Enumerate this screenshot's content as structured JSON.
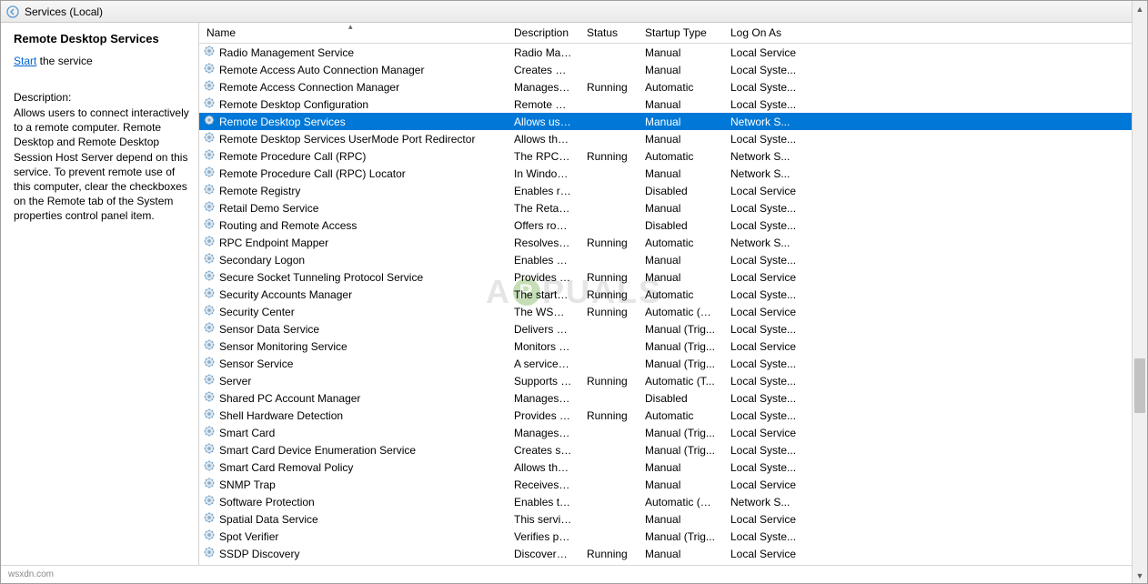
{
  "header": {
    "title": "Services (Local)"
  },
  "leftPane": {
    "serviceName": "Remote Desktop Services",
    "actionPrefix": "Start",
    "actionSuffix": " the service",
    "descLabel": "Description:",
    "descText": "Allows users to connect interactively to a remote computer. Remote Desktop and Remote Desktop Session Host Server depend on this service.  To prevent remote use of this computer, clear the checkboxes on the Remote tab of the System properties control panel item."
  },
  "columns": {
    "name": "Name",
    "description": "Description",
    "status": "Status",
    "startupType": "Startup Type",
    "logOnAs": "Log On As"
  },
  "selectedIndex": 4,
  "services": [
    {
      "name": "Radio Management Service",
      "desc": "Radio Mana...",
      "status": "",
      "startup": "Manual",
      "logon": "Local Service"
    },
    {
      "name": "Remote Access Auto Connection Manager",
      "desc": "Creates a co...",
      "status": "",
      "startup": "Manual",
      "logon": "Local Syste..."
    },
    {
      "name": "Remote Access Connection Manager",
      "desc": "Manages di...",
      "status": "Running",
      "startup": "Automatic",
      "logon": "Local Syste..."
    },
    {
      "name": "Remote Desktop Configuration",
      "desc": "Remote Des...",
      "status": "",
      "startup": "Manual",
      "logon": "Local Syste..."
    },
    {
      "name": "Remote Desktop Services",
      "desc": "Allows user...",
      "status": "",
      "startup": "Manual",
      "logon": "Network S..."
    },
    {
      "name": "Remote Desktop Services UserMode Port Redirector",
      "desc": "Allows the r...",
      "status": "",
      "startup": "Manual",
      "logon": "Local Syste..."
    },
    {
      "name": "Remote Procedure Call (RPC)",
      "desc": "The RPCSS ...",
      "status": "Running",
      "startup": "Automatic",
      "logon": "Network S..."
    },
    {
      "name": "Remote Procedure Call (RPC) Locator",
      "desc": "In Windows...",
      "status": "",
      "startup": "Manual",
      "logon": "Network S..."
    },
    {
      "name": "Remote Registry",
      "desc": "Enables rem...",
      "status": "",
      "startup": "Disabled",
      "logon": "Local Service"
    },
    {
      "name": "Retail Demo Service",
      "desc": "The Retail D...",
      "status": "",
      "startup": "Manual",
      "logon": "Local Syste..."
    },
    {
      "name": "Routing and Remote Access",
      "desc": "Offers routi...",
      "status": "",
      "startup": "Disabled",
      "logon": "Local Syste..."
    },
    {
      "name": "RPC Endpoint Mapper",
      "desc": "Resolves RP...",
      "status": "Running",
      "startup": "Automatic",
      "logon": "Network S..."
    },
    {
      "name": "Secondary Logon",
      "desc": "Enables star...",
      "status": "",
      "startup": "Manual",
      "logon": "Local Syste..."
    },
    {
      "name": "Secure Socket Tunneling Protocol Service",
      "desc": "Provides su...",
      "status": "Running",
      "startup": "Manual",
      "logon": "Local Service"
    },
    {
      "name": "Security Accounts Manager",
      "desc": "The startup ...",
      "status": "Running",
      "startup": "Automatic",
      "logon": "Local Syste..."
    },
    {
      "name": "Security Center",
      "desc": "The WSCSV...",
      "status": "Running",
      "startup": "Automatic (D...",
      "logon": "Local Service"
    },
    {
      "name": "Sensor Data Service",
      "desc": "Delivers dat...",
      "status": "",
      "startup": "Manual (Trig...",
      "logon": "Local Syste..."
    },
    {
      "name": "Sensor Monitoring Service",
      "desc": "Monitors va...",
      "status": "",
      "startup": "Manual (Trig...",
      "logon": "Local Service"
    },
    {
      "name": "Sensor Service",
      "desc": "A service fo...",
      "status": "",
      "startup": "Manual (Trig...",
      "logon": "Local Syste..."
    },
    {
      "name": "Server",
      "desc": "Supports fil...",
      "status": "Running",
      "startup": "Automatic (T...",
      "logon": "Local Syste..."
    },
    {
      "name": "Shared PC Account Manager",
      "desc": "Manages pr...",
      "status": "",
      "startup": "Disabled",
      "logon": "Local Syste..."
    },
    {
      "name": "Shell Hardware Detection",
      "desc": "Provides no...",
      "status": "Running",
      "startup": "Automatic",
      "logon": "Local Syste..."
    },
    {
      "name": "Smart Card",
      "desc": "Manages ac...",
      "status": "",
      "startup": "Manual (Trig...",
      "logon": "Local Service"
    },
    {
      "name": "Smart Card Device Enumeration Service",
      "desc": "Creates soft...",
      "status": "",
      "startup": "Manual (Trig...",
      "logon": "Local Syste..."
    },
    {
      "name": "Smart Card Removal Policy",
      "desc": "Allows the s...",
      "status": "",
      "startup": "Manual",
      "logon": "Local Syste..."
    },
    {
      "name": "SNMP Trap",
      "desc": "Receives tra...",
      "status": "",
      "startup": "Manual",
      "logon": "Local Service"
    },
    {
      "name": "Software Protection",
      "desc": "Enables the ...",
      "status": "",
      "startup": "Automatic (D...",
      "logon": "Network S..."
    },
    {
      "name": "Spatial Data Service",
      "desc": "This service ...",
      "status": "",
      "startup": "Manual",
      "logon": "Local Service"
    },
    {
      "name": "Spot Verifier",
      "desc": "Verifies pote...",
      "status": "",
      "startup": "Manual (Trig...",
      "logon": "Local Syste..."
    },
    {
      "name": "SSDP Discovery",
      "desc": "Discovers n...",
      "status": "Running",
      "startup": "Manual",
      "logon": "Local Service"
    }
  ],
  "footer": {
    "source": "wsxdn.com"
  }
}
